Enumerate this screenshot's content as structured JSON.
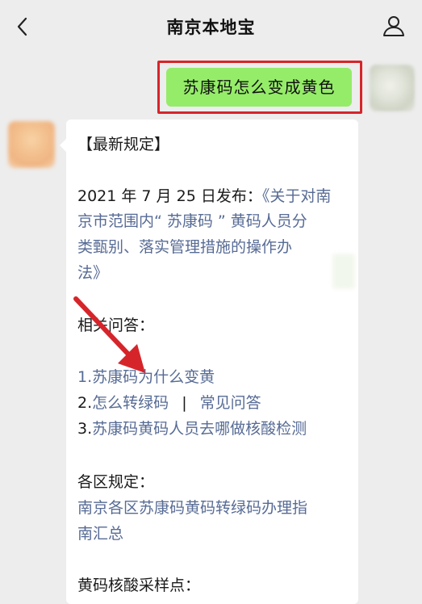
{
  "header": {
    "title": "南京本地宝",
    "back_icon": "chevron-left-icon",
    "profile_icon": "person-icon"
  },
  "user_message": {
    "text": "苏康码怎么变成黄色"
  },
  "bot_message": {
    "heading": "【最新规定】",
    "publish_prefix": "2021 年 7 月 25 日发布：",
    "doc_line1": "《关于对南",
    "doc_line2": "京市范围内“ 苏康码 ” 黄码人员分",
    "doc_line3": "类甄别、落实管理措施的操作办",
    "doc_line4": "法》",
    "related_title": "相关问答：",
    "q1": "1.苏康码为什么变黄",
    "q2_num": "2.",
    "q2_link": "怎么转绿码",
    "q2_sep": "|",
    "q2_link2": "常见问答",
    "q3_num": "3.",
    "q3_link": "苏康码黄码人员去哪做核酸检测",
    "district_title": "各区规定：",
    "district_line1": "南京各区苏康码黄码转绿码办理指",
    "district_line2": "南汇总",
    "sampling_title": "黄码核酸采样点："
  },
  "colors": {
    "link": "#576b95",
    "my_bubble": "#95ec69",
    "highlight": "#d6252a"
  }
}
